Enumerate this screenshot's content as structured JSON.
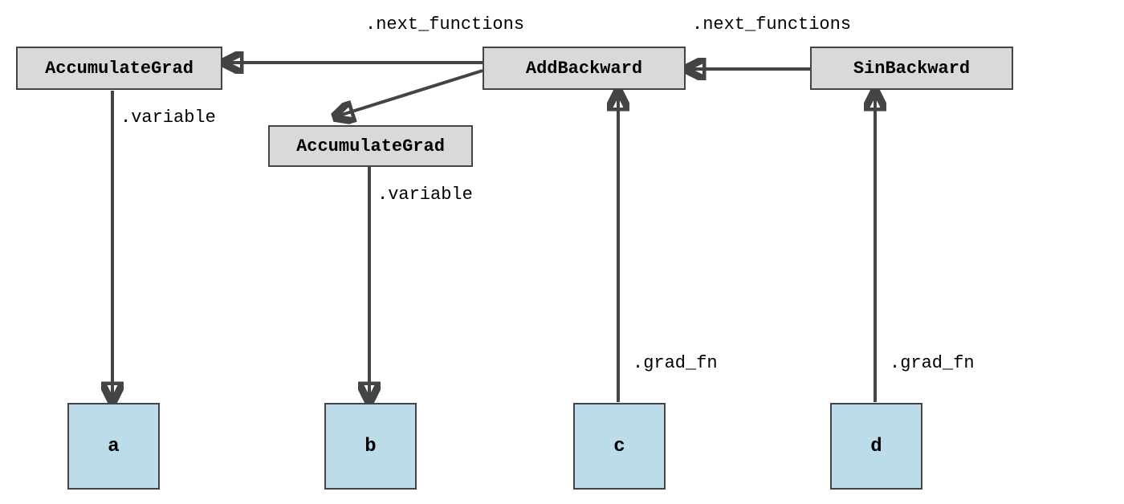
{
  "nodes": {
    "accgrad_a": {
      "label": "AccumulateGrad"
    },
    "accgrad_b": {
      "label": "AccumulateGrad"
    },
    "addback": {
      "label": "AddBackward"
    },
    "sinback": {
      "label": "SinBackward"
    },
    "var_a": {
      "label": "a"
    },
    "var_b": {
      "label": "b"
    },
    "var_c": {
      "label": "c"
    },
    "var_d": {
      "label": "d"
    }
  },
  "edge_labels": {
    "next_functions_1": ".next_functions",
    "next_functions_2": ".next_functions",
    "variable_a": ".variable",
    "variable_b": ".variable",
    "grad_fn_c": ".grad_fn",
    "grad_fn_d": ".grad_fn"
  }
}
